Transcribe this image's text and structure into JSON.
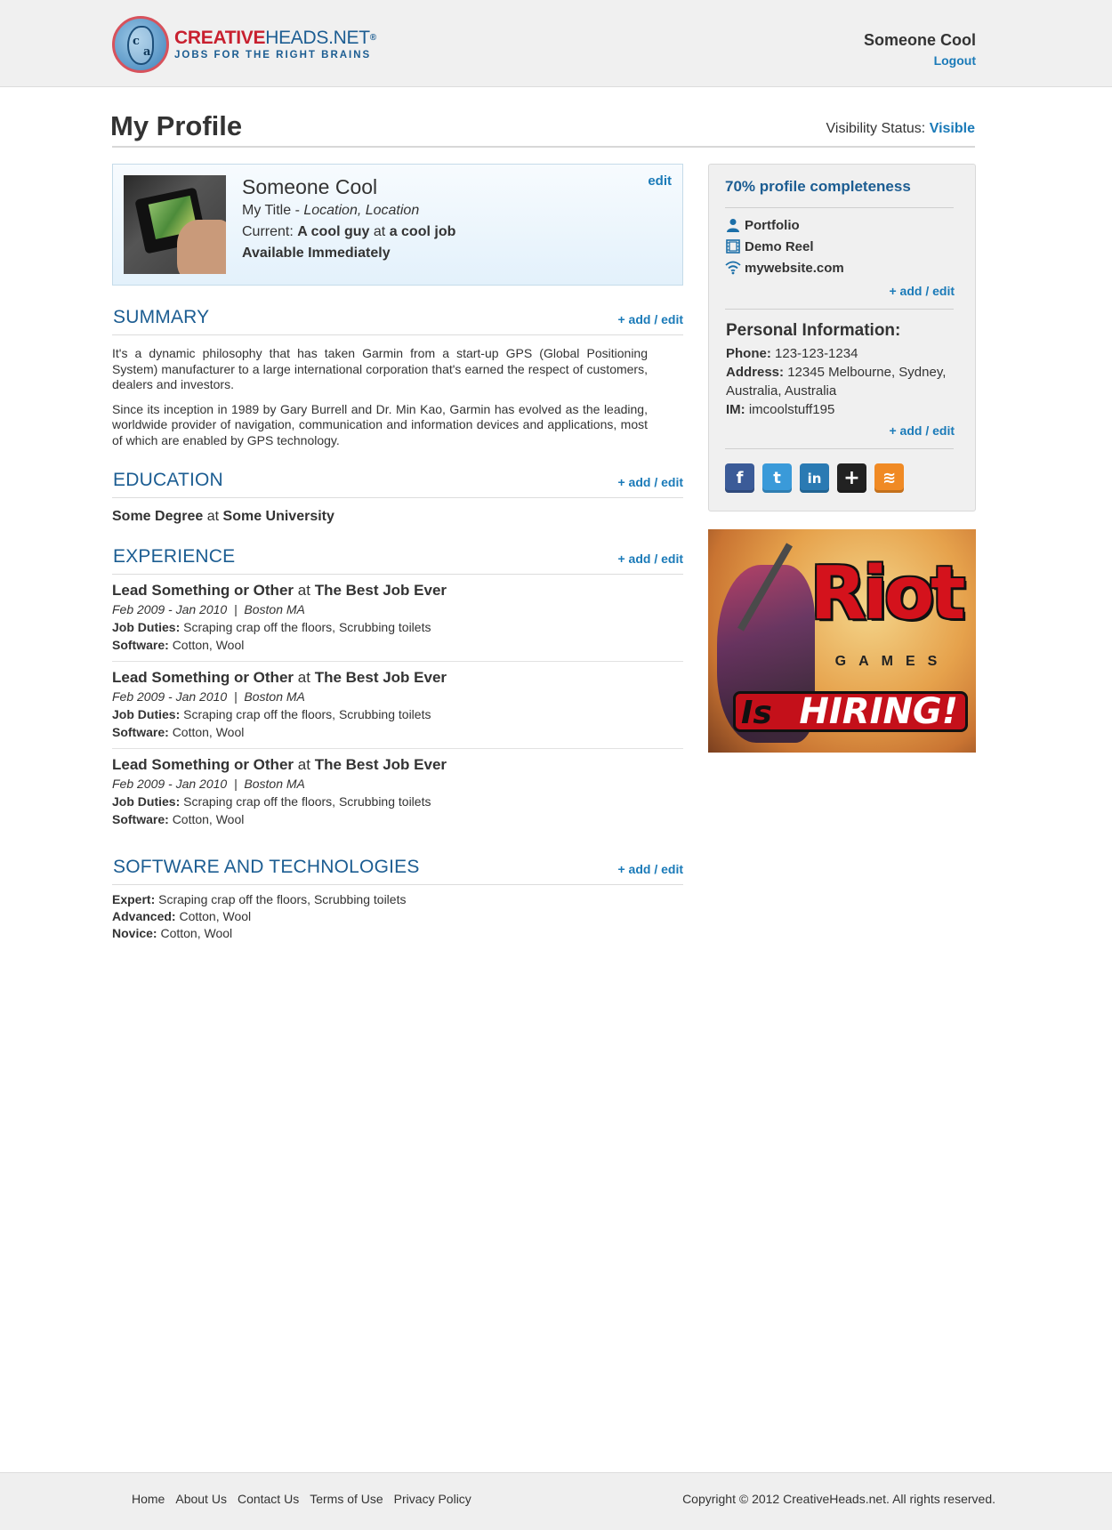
{
  "header": {
    "logo": {
      "word_red": "CREATIVE",
      "word_blue": "HEADS.NET",
      "reg": "®",
      "tagline": "JOBS FOR THE RIGHT BRAINS"
    },
    "user_name": "Someone Cool",
    "logout_label": "Logout"
  },
  "page": {
    "title": "My Profile",
    "visibility_label": "Visibility Status:",
    "visibility_value": "Visible"
  },
  "profile": {
    "name": "Someone Cool",
    "title": "My Title",
    "title_sep": " - ",
    "location": "Location, Location",
    "current_label": "Current:",
    "current_role": "A cool guy",
    "current_at": "at",
    "current_company": "a cool job",
    "availability": "Available Immediately",
    "edit_label": "edit"
  },
  "summary": {
    "heading": "SUMMARY",
    "action": "+ add / edit",
    "paragraphs": [
      "It's a dynamic philosophy that has taken Garmin from a start-up GPS (Global Positioning System) manufacturer to a large international corporation that's earned the respect of customers, dealers and investors.",
      "Since its inception in 1989 by Gary Burrell and Dr. Min Kao, Garmin has evolved as the leading, worldwide provider of navigation, communication and information devices and applications, most of which are enabled by GPS technology."
    ]
  },
  "education": {
    "heading": "EDUCATION",
    "action": "+ add / edit",
    "degree": "Some Degree",
    "at": "at",
    "school": "Some University"
  },
  "experience": {
    "heading": "EXPERIENCE",
    "action": "+ add / edit",
    "items": [
      {
        "role": "Lead Something or Other",
        "at": "at",
        "company": "The Best Job Ever",
        "dates": "Feb 2009 - Jan 2010",
        "sep": "|",
        "location": "Boston MA",
        "duties_label": "Job Duties:",
        "duties": "Scraping crap off the floors, Scrubbing toilets",
        "software_label": "Software:",
        "software": "Cotton, Wool"
      },
      {
        "role": "Lead Something or Other",
        "at": "at",
        "company": "The Best Job Ever",
        "dates": "Feb 2009 - Jan 2010",
        "sep": "|",
        "location": "Boston MA",
        "duties_label": "Job Duties:",
        "duties": "Scraping crap off the floors, Scrubbing toilets",
        "software_label": "Software:",
        "software": "Cotton, Wool"
      },
      {
        "role": "Lead Something or Other",
        "at": "at",
        "company": "The Best Job Ever",
        "dates": "Feb 2009 - Jan 2010",
        "sep": "|",
        "location": "Boston MA",
        "duties_label": "Job Duties:",
        "duties": "Scraping crap off the floors, Scrubbing toilets",
        "software_label": "Software:",
        "software": "Cotton, Wool"
      }
    ]
  },
  "software": {
    "heading": "SOFTWARE AND TECHNOLOGIES",
    "action": "+ add / edit",
    "rows": [
      {
        "label": "Expert:",
        "value": "Scraping crap off the floors, Scrubbing toilets"
      },
      {
        "label": "Advanced:",
        "value": "Cotton, Wool"
      },
      {
        "label": "Novice:",
        "value": "Cotton, Wool"
      }
    ]
  },
  "sidebar": {
    "completeness": "70% profile completeness",
    "links": [
      {
        "icon": "person-icon",
        "label": "Portfolio"
      },
      {
        "icon": "film-icon",
        "label": "Demo Reel"
      },
      {
        "icon": "wifi-icon",
        "label": "mywebsite.com"
      }
    ],
    "links_action": "+ add / edit",
    "personal_title": "Personal Information:",
    "phone_label": "Phone:",
    "phone": "123-123-1234",
    "address_label": "Address:",
    "address": "12345 Melbourne, Sydney, Australia, Australia",
    "im_label": "IM:",
    "im": "imcoolstuff195",
    "personal_action": "+ add / edit",
    "social": [
      {
        "name": "facebook-icon",
        "glyph": "f",
        "color": "#3b5b98"
      },
      {
        "name": "twitter-icon",
        "glyph": "t",
        "color": "#3a9ad9"
      },
      {
        "name": "linkedin-icon",
        "glyph": "in",
        "color": "#2a7ab3"
      },
      {
        "name": "googleplus-icon",
        "glyph": "+",
        "color": "#222222"
      },
      {
        "name": "rss-icon",
        "glyph": "≋",
        "color": "#f08a24"
      }
    ]
  },
  "ad": {
    "logo_text": "Riot",
    "games_text": "GAMES",
    "banner_is": "Is",
    "banner_text": "HIRING!"
  },
  "footer": {
    "links": [
      "Home",
      "About Us",
      "Contact Us",
      "Terms of Use",
      "Privacy Policy"
    ],
    "copyright": "Copyright © 2012 CreativeHeads.net. All rights reserved."
  }
}
